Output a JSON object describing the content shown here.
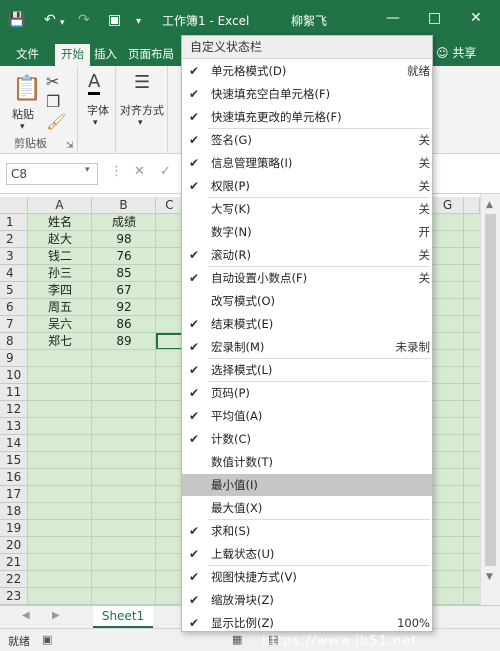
{
  "window": {
    "doc_title": "工作簿1  -  Excel",
    "user": "柳絮飞"
  },
  "tabs": [
    "文件",
    "开始",
    "插入",
    "页面布局"
  ],
  "share_label": "共享",
  "ribbon": {
    "paste": "粘贴",
    "clipboard": "剪贴板",
    "font": "字体",
    "align": "对齐方式"
  },
  "formula_bar": {
    "name_box": "C8"
  },
  "grid": {
    "columns": [
      "A",
      "B",
      "C",
      "G"
    ],
    "rows": [
      "1",
      "2",
      "3",
      "4",
      "5",
      "6",
      "7",
      "8",
      "9",
      "10",
      "11",
      "12",
      "13",
      "14",
      "15",
      "16",
      "17",
      "18",
      "19",
      "20",
      "21",
      "22",
      "23"
    ],
    "data": [
      [
        "姓名",
        "成绩"
      ],
      [
        "赵大",
        "98"
      ],
      [
        "钱二",
        "76"
      ],
      [
        "孙三",
        "85"
      ],
      [
        "李四",
        "67"
      ],
      [
        "周五",
        "92"
      ],
      [
        "吴六",
        "86"
      ],
      [
        "郑七",
        "89"
      ]
    ]
  },
  "sheet_tab": "Sheet1",
  "status": {
    "mode": "就绪"
  },
  "menu": {
    "title": "自定义状态栏",
    "items": [
      {
        "label": "单元格模式(D)",
        "value": "就绪",
        "checked": true
      },
      {
        "label": "快速填充空白单元格(F)",
        "value": "",
        "checked": true
      },
      {
        "label": "快速填充更改的单元格(F)",
        "value": "",
        "checked": true
      },
      {
        "label": "签名(G)",
        "value": "关",
        "checked": true
      },
      {
        "label": "信息管理策略(I)",
        "value": "关",
        "checked": true
      },
      {
        "label": "权限(P)",
        "value": "关",
        "checked": true
      },
      {
        "label": "大写(K)",
        "value": "关",
        "checked": false
      },
      {
        "label": "数字(N)",
        "value": "开",
        "checked": false
      },
      {
        "label": "滚动(R)",
        "value": "关",
        "checked": true
      },
      {
        "label": "自动设置小数点(F)",
        "value": "关",
        "checked": true
      },
      {
        "label": "改写模式(O)",
        "value": "",
        "checked": false
      },
      {
        "label": "结束模式(E)",
        "value": "",
        "checked": true
      },
      {
        "label": "宏录制(M)",
        "value": "未录制",
        "checked": true
      },
      {
        "label": "选择模式(L)",
        "value": "",
        "checked": true
      },
      {
        "label": "页码(P)",
        "value": "",
        "checked": true
      },
      {
        "label": "平均值(A)",
        "value": "",
        "checked": true
      },
      {
        "label": "计数(C)",
        "value": "",
        "checked": true
      },
      {
        "label": "数值计数(T)",
        "value": "",
        "checked": false
      },
      {
        "label": "最小值(I)",
        "value": "",
        "checked": false
      },
      {
        "label": "最大值(X)",
        "value": "",
        "checked": false
      },
      {
        "label": "求和(S)",
        "value": "",
        "checked": true
      },
      {
        "label": "上载状态(U)",
        "value": "",
        "checked": true
      },
      {
        "label": "视图快捷方式(V)",
        "value": "",
        "checked": true
      },
      {
        "label": "缩放滑块(Z)",
        "value": "",
        "checked": true
      },
      {
        "label": "显示比例(Z)",
        "value": "100%",
        "checked": true
      }
    ]
  }
}
